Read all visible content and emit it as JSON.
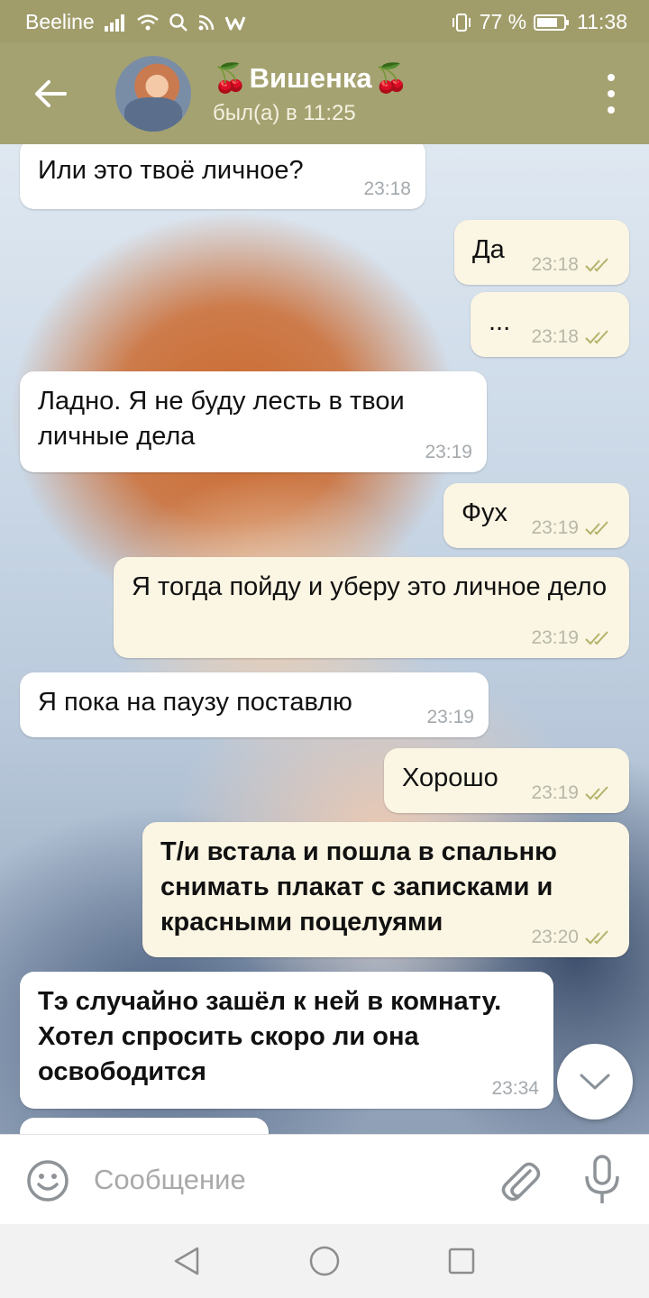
{
  "status_bar": {
    "carrier": "Beeline",
    "battery": "77 %",
    "time": "11:38"
  },
  "header": {
    "title": "Вишенка",
    "title_emoji": "🍒",
    "status": "был(а) в 11:25",
    "back_icon": "arrow-left-icon",
    "menu_icon": "more-vertical-icon"
  },
  "messages": [
    {
      "dir": "in",
      "text": "Или это твоё личное?",
      "time": "23:18"
    },
    {
      "dir": "out",
      "text": "Да",
      "time": "23:18",
      "read": true
    },
    {
      "dir": "out",
      "text": "...",
      "time": "23:18",
      "read": true
    },
    {
      "dir": "in",
      "text": "Ладно. Я не буду лесть в твои личные дела",
      "time": "23:19"
    },
    {
      "dir": "out",
      "text": "Фух",
      "time": "23:19",
      "read": true
    },
    {
      "dir": "out",
      "text": "Я тогда пойду и уберу это личное дело",
      "time": "23:19",
      "read": true
    },
    {
      "dir": "in",
      "text": "Я пока на паузу поставлю",
      "time": "23:19"
    },
    {
      "dir": "out",
      "text": "Хорошо",
      "time": "23:19",
      "read": true
    },
    {
      "dir": "out",
      "text": "Т/и встала и пошла в спальню снимать плакат с записками и красными поцелуями",
      "time": "23:20",
      "read": true,
      "bold": true
    },
    {
      "dir": "in",
      "text": "Тэ случайно зашёл к ней в комнату. Хотел спросить скоро ли она освободится",
      "time": "23:34",
      "bold": true
    }
  ],
  "input": {
    "placeholder": "Сообщение",
    "emoji_icon": "smiley-icon",
    "attach_icon": "paperclip-icon",
    "mic_icon": "microphone-icon"
  },
  "colors": {
    "header": "#a5a271",
    "status_bar": "#a19d6b",
    "incoming_bubble": "#ffffff",
    "outgoing_bubble": "#fbf5e3",
    "read_ticks": "#b3b36a"
  }
}
